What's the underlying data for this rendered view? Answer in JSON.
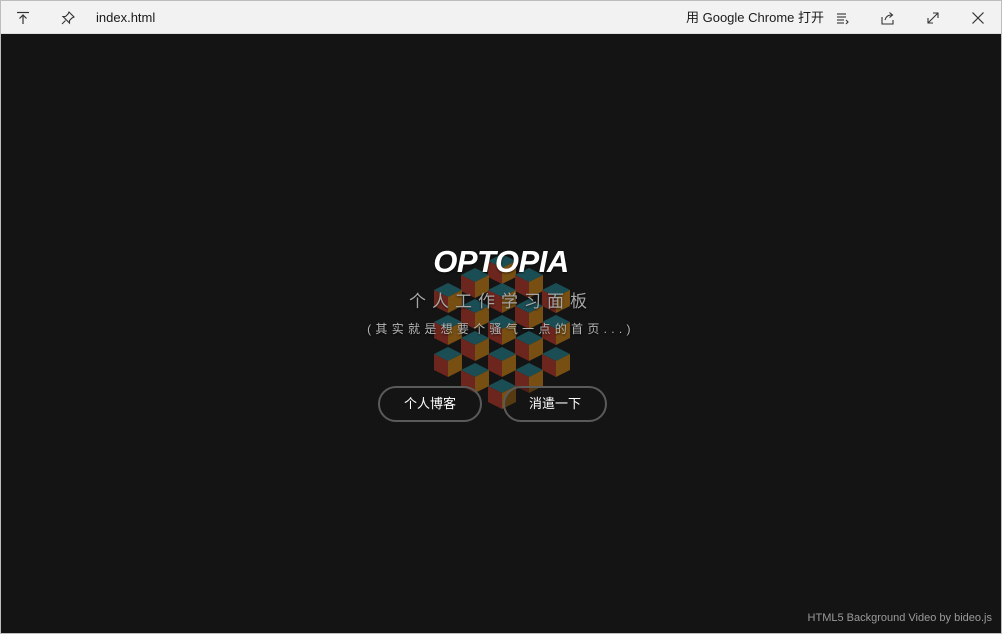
{
  "titlebar": {
    "filename": "index.html",
    "open_with": "用 Google Chrome 打开",
    "icons": [
      "pin-top-icon",
      "pin-icon",
      "list-icon",
      "share-icon",
      "expand-icon",
      "close-icon"
    ]
  },
  "hero": {
    "title": "OPTOPIA",
    "subtitle": "个人工作学习面板",
    "tagline": "(其实就是想要个骚气一点的首页...)"
  },
  "buttons": {
    "blog": "个人博客",
    "fun": "消遣一下"
  },
  "footer": {
    "credit": "HTML5 Background Video by bideo.js"
  },
  "colors": {
    "background": "#141414",
    "titlebar": "#f2f2f2",
    "cube_top": "#1d5960",
    "cube_left": "#7d2a1f",
    "cube_right": "#8a5a12"
  }
}
